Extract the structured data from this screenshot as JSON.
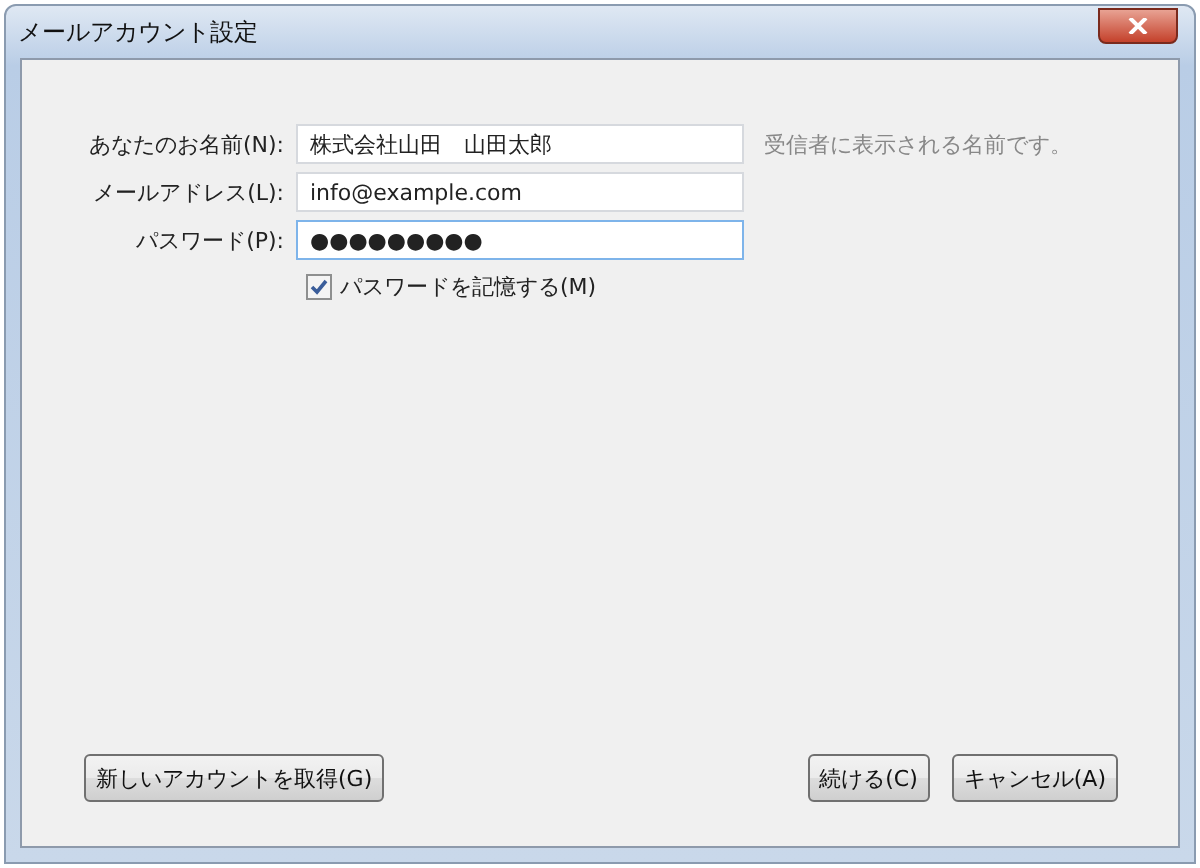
{
  "window": {
    "title": "メールアカウント設定"
  },
  "fields": [
    {
      "label": "あなたのお名前(N):",
      "value": "株式会社山田　山田太郎",
      "hint": "受信者に表示される名前です。",
      "focused": false
    },
    {
      "label": "メールアドレス(L):",
      "value": "info@example.com",
      "focused": false
    },
    {
      "label": "パスワード(P):",
      "value": "●●●●●●●●●",
      "focused": true
    }
  ],
  "remember_password": {
    "label": "パスワードを記憶する(M)",
    "checked": true
  },
  "buttons": {
    "left": [
      "新しいアカウントを取得(G)"
    ],
    "right": [
      "続ける(C)",
      "キャンセル(A)"
    ]
  }
}
